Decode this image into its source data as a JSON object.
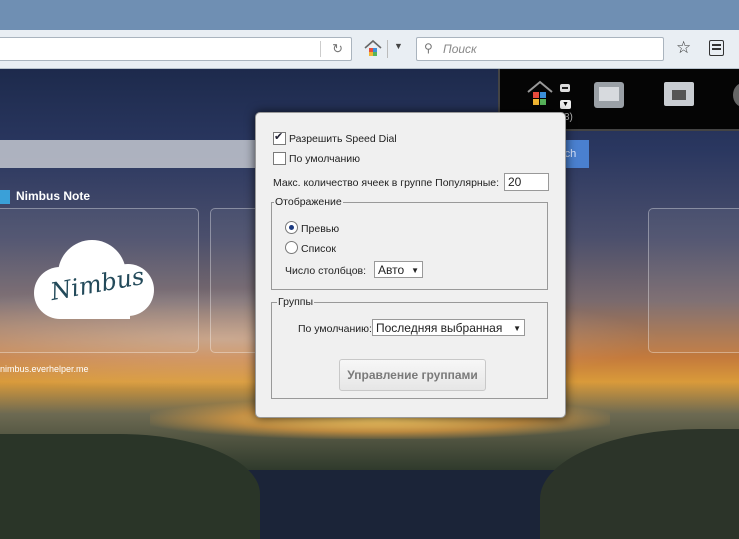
{
  "browser": {
    "search_placeholder": "Поиск"
  },
  "page": {
    "search_button_label": "rch",
    "group_tab_label": "Nimbus Note",
    "tile_logo_text": "Nimbus",
    "tile_url": "nimbus.everhelper.me",
    "groups_count": "3)"
  },
  "dialog": {
    "enable_speed_dial": {
      "label": "Разрешить Speed Dial",
      "checked": true
    },
    "default": {
      "label": "По умолчанию",
      "checked": false
    },
    "max_cells_label": "Макс. количество ячеек в группе Популярные:",
    "max_cells_value": "20",
    "display": {
      "legend": "Отображение",
      "preview_label": "Превью",
      "list_label": "Список",
      "selected": "preview",
      "columns_label": "Число столбцов:",
      "columns_value": "Авто"
    },
    "groups": {
      "legend": "Группы",
      "default_label": "По умолчанию:",
      "default_value": "Последняя выбранная",
      "manage_button": "Управление группами"
    }
  }
}
